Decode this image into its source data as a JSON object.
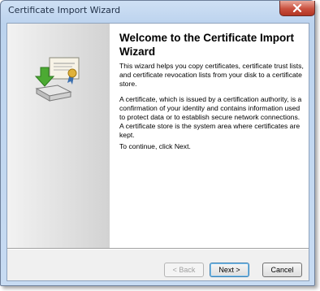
{
  "window": {
    "title": "Certificate Import Wizard"
  },
  "page": {
    "heading": "Welcome to the Certificate Import Wizard",
    "paragraphs": [
      "This wizard helps you copy certificates, certificate trust lists, and certificate revocation lists from your disk to a certificate store.",
      "A certificate, which is issued by a certification authority, is a confirmation of your identity and contains information used to protect data or to establish secure network connections. A certificate store is the system area where certificates are kept.",
      "To continue, click Next."
    ]
  },
  "buttons": {
    "back": "< Back",
    "next": "Next >",
    "cancel": "Cancel"
  },
  "icons": {
    "close": "close-icon",
    "wizard": "certificate-import-icon"
  },
  "colors": {
    "titlebar": "#c7dbf2",
    "close_button": "#c9503e",
    "default_button_border": "#3c7fb1"
  }
}
